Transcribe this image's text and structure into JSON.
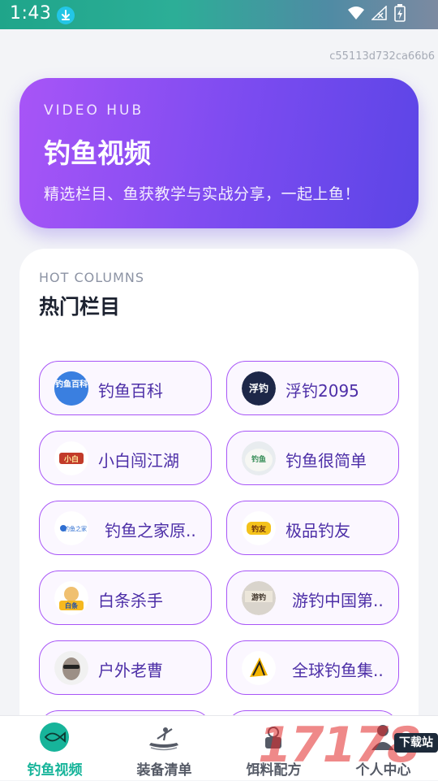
{
  "status_bar": {
    "time": "1:43",
    "icons": [
      "download-icon",
      "wifi-icon",
      "no-signal-icon",
      "battery-icon"
    ]
  },
  "page_id": "c55113d732ca66b6",
  "hero": {
    "eyebrow": "VIDEO HUB",
    "title": "钓鱼视频",
    "subtitle": "精选栏目、鱼获教学与实战分享，一起上鱼！"
  },
  "columns": {
    "eyebrow": "HOT COLUMNS",
    "title": "热门栏目",
    "items": [
      {
        "label": "钓鱼百科",
        "logo": "钓鱼百科"
      },
      {
        "label": "浮钓2095",
        "logo": "浮钓"
      },
      {
        "label": "小白闯江湖",
        "logo": "小白"
      },
      {
        "label": "钓鱼很简单",
        "logo": "钓鱼"
      },
      {
        "label": "钓鱼之家原..",
        "logo": "钓鱼之家"
      },
      {
        "label": "极品钓友",
        "logo": "钓友"
      },
      {
        "label": "白条杀手",
        "logo": "白条"
      },
      {
        "label": "游钓中国第..",
        "logo": "游钓"
      },
      {
        "label": "户外老曹",
        "logo": ""
      },
      {
        "label": "全球钓鱼集..",
        "logo": ""
      }
    ]
  },
  "bottom_nav": {
    "items": [
      {
        "label": "钓鱼视频",
        "icon": "fish-icon",
        "active": true
      },
      {
        "label": "装备清单",
        "icon": "kayak-icon",
        "active": false
      },
      {
        "label": "饵料配方",
        "icon": "bait-icon",
        "active": false
      },
      {
        "label": "个人中心",
        "icon": "person-icon",
        "active": false
      }
    ]
  },
  "watermark": {
    "number": "17178",
    "badge": "下载站"
  },
  "colors": {
    "accent": "#a855f7",
    "hero_start": "#a855f7",
    "hero_end": "#5b45e6",
    "nav_active": "#17b49a"
  }
}
